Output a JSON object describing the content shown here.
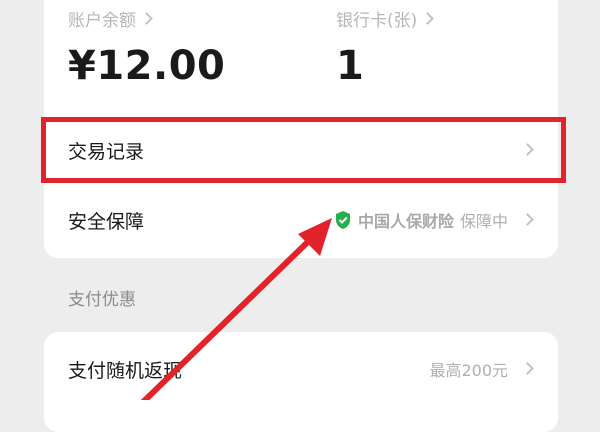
{
  "summary": {
    "balance_label": "账户余额",
    "balance_value": "¥12.00",
    "cards_label": "银行卡(张)",
    "cards_value": "1"
  },
  "menu": {
    "transactions_label": "交易记录",
    "security_label": "安全保障",
    "security_insurer": "中国人保财险",
    "security_status": "保障中"
  },
  "section": {
    "title": "支付优惠"
  },
  "promo": {
    "label": "支付随机返现",
    "value": "最高200元"
  },
  "colors": {
    "highlight": "#e2232a",
    "shield": "#23b14d"
  },
  "icons": [
    "chevron-right-icon",
    "shield-check-icon",
    "arrow-annotation"
  ]
}
